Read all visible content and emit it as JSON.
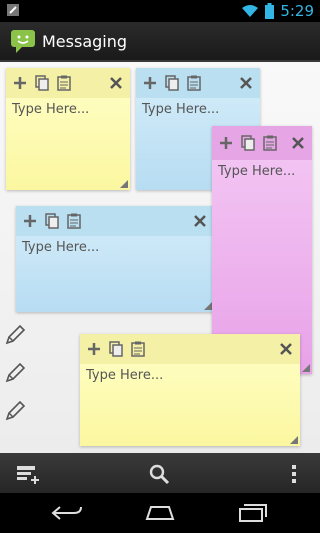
{
  "status": {
    "time": "5:29",
    "icons": [
      "edit-icon",
      "wifi-icon",
      "battery-icon"
    ]
  },
  "app": {
    "title": "Messaging",
    "icon": "chat-bubble-icon"
  },
  "notes": [
    {
      "color": "yellow",
      "placeholder": "Type Here..."
    },
    {
      "color": "blue",
      "placeholder": "Type Here..."
    },
    {
      "color": "pink",
      "placeholder": "Type Here..."
    },
    {
      "color": "blue",
      "placeholder": "Type Here..."
    },
    {
      "color": "yellow",
      "placeholder": "Type Here..."
    }
  ],
  "note_toolbar_icons": [
    "add-icon",
    "copy-icon",
    "paste-icon",
    "close-icon"
  ],
  "bottom_actions": [
    "add-note-icon",
    "search-icon",
    "overflow-menu-icon"
  ],
  "nav_buttons": [
    "back-icon",
    "home-icon",
    "recents-icon"
  ],
  "colors": {
    "accent": "#33b5e5",
    "yellow": "#fbf7a0",
    "blue": "#b7dcf2",
    "pink": "#e8a2e8"
  }
}
